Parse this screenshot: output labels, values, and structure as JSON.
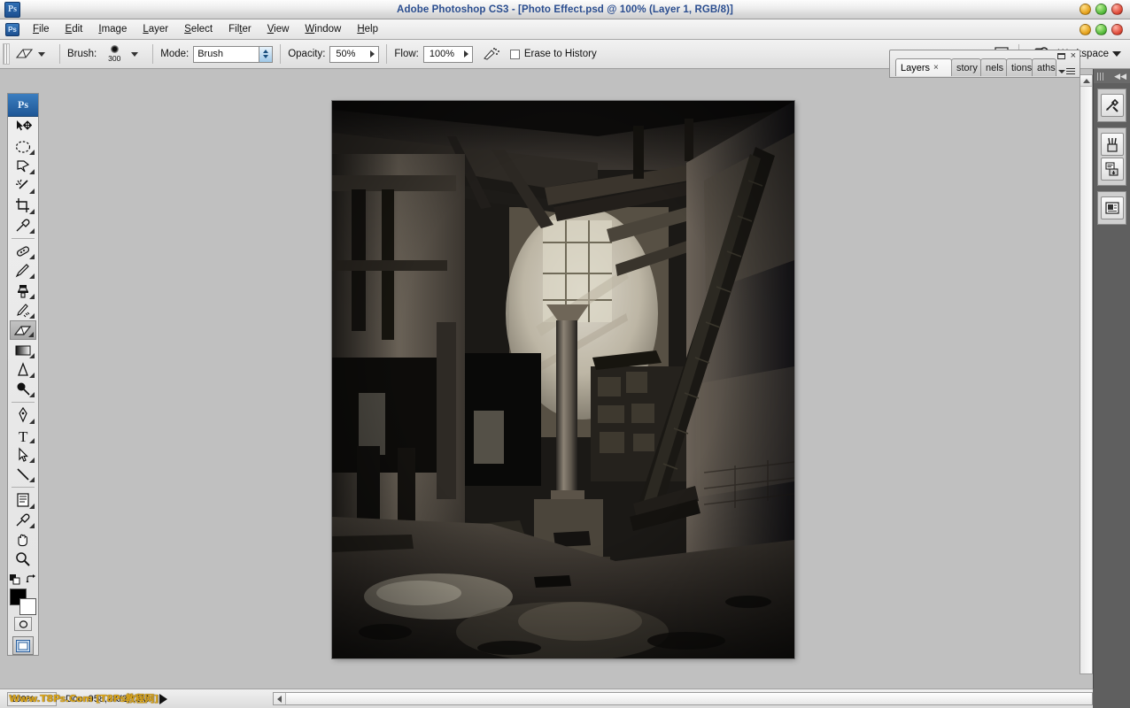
{
  "window": {
    "title": "Adobe Photoshop CS3 - [Photo Effect.psd @ 100% (Layer 1, RGB/8)]",
    "app_badge": "Ps",
    "controls": {
      "minimize": "minimize",
      "maximize": "maximize",
      "close": "close"
    }
  },
  "menubar": {
    "items": [
      {
        "label": "File",
        "accel": "F"
      },
      {
        "label": "Edit",
        "accel": "E"
      },
      {
        "label": "Image",
        "accel": "I"
      },
      {
        "label": "Layer",
        "accel": "L"
      },
      {
        "label": "Select",
        "accel": "S"
      },
      {
        "label": "Filter",
        "accel": "t"
      },
      {
        "label": "View",
        "accel": "V"
      },
      {
        "label": "Window",
        "accel": "W"
      },
      {
        "label": "Help",
        "accel": "H"
      }
    ]
  },
  "options_bar": {
    "active_tool": "eraser",
    "brush_label": "Brush:",
    "brush_size": "300",
    "mode_label": "Mode:",
    "mode_value": "Brush",
    "opacity_label": "Opacity:",
    "opacity_value": "50%",
    "flow_label": "Flow:",
    "flow_value": "100%",
    "airbrush_icon": "airbrush-icon",
    "erase_to_history_label": "Erase to History",
    "erase_to_history_checked": false,
    "palette_toggle_icon": "palette-toggle-icon",
    "bridge_icon": "bridge-icon",
    "bridge_badge": "Br",
    "workspace_label": "Workspace"
  },
  "toolbox": {
    "header_badge": "Ps",
    "tools": [
      {
        "name": "move-tool",
        "selected": false,
        "has_flyout": false
      },
      {
        "name": "elliptical-marquee-tool",
        "selected": false,
        "has_flyout": true
      },
      {
        "name": "lasso-tool",
        "selected": false,
        "has_flyout": true
      },
      {
        "name": "magic-wand-tool",
        "selected": false,
        "has_flyout": true
      },
      {
        "name": "crop-tool",
        "selected": false,
        "has_flyout": true
      },
      {
        "name": "eyedropper-tool",
        "selected": false,
        "has_flyout": true
      },
      {
        "name": "healing-brush-tool",
        "selected": false,
        "has_flyout": true
      },
      {
        "name": "brush-tool",
        "selected": false,
        "has_flyout": true
      },
      {
        "name": "clone-stamp-tool",
        "selected": false,
        "has_flyout": true
      },
      {
        "name": "history-brush-tool",
        "selected": false,
        "has_flyout": true
      },
      {
        "name": "eraser-tool",
        "selected": true,
        "has_flyout": true
      },
      {
        "name": "gradient-tool",
        "selected": false,
        "has_flyout": true
      },
      {
        "name": "blur-tool",
        "selected": false,
        "has_flyout": true
      },
      {
        "name": "dodge-tool",
        "selected": false,
        "has_flyout": true
      },
      {
        "name": "pen-tool",
        "selected": false,
        "has_flyout": true
      },
      {
        "name": "type-tool",
        "selected": false,
        "has_flyout": true
      },
      {
        "name": "path-selection-tool",
        "selected": false,
        "has_flyout": true
      },
      {
        "name": "line-tool",
        "selected": false,
        "has_flyout": true
      },
      {
        "name": "notes-tool",
        "selected": false,
        "has_flyout": true
      },
      {
        "name": "color-sampler-tool",
        "selected": false,
        "has_flyout": true
      },
      {
        "name": "hand-tool",
        "selected": false,
        "has_flyout": false
      },
      {
        "name": "zoom-tool",
        "selected": false,
        "has_flyout": false
      }
    ],
    "foreground_color": "#000000",
    "background_color": "#ffffff",
    "quick_mask_label": "quick-mask-mode",
    "screen_mode_label": "screen-mode"
  },
  "panel": {
    "tabs": [
      {
        "label": "Layers",
        "active": true,
        "closable": true
      },
      {
        "label": "story",
        "active": false,
        "closable": false
      },
      {
        "label": "nels",
        "active": false,
        "closable": false
      },
      {
        "label": "tions",
        "active": false,
        "closable": false
      },
      {
        "label": "aths",
        "active": false,
        "closable": false
      }
    ],
    "minimize": "minimize",
    "close": "close",
    "menu_icon": "panel-menu-icon"
  },
  "right_dock": {
    "collapse_icon": "collapse-dock-icon",
    "buttons": [
      {
        "name": "tool-presets-icon"
      },
      {
        "name": "brushes-panel-icon"
      },
      {
        "name": "clone-source-panel-icon"
      },
      {
        "name": "layer-comps-panel-icon"
      }
    ]
  },
  "status_bar": {
    "zoom_value": "100%",
    "doc_info": "Doc: 958,2K/2,18M",
    "watermark": "Www.T8Ps.Com [T8Ps教程网]",
    "expand_icon": "expand-status-icon"
  },
  "document": {
    "name": "Photo Effect.psd",
    "zoom": "100%",
    "layer": "Layer 1",
    "color_mode": "RGB/8",
    "image_description": "abandoned dark industrial interior with concrete columns, steel beams and rubble floor"
  },
  "colors": {
    "title_text": "#2a4d8f",
    "app_background": "#c0c0c0",
    "dock_background": "#5f5f5f",
    "watermark": "#d8a319"
  }
}
